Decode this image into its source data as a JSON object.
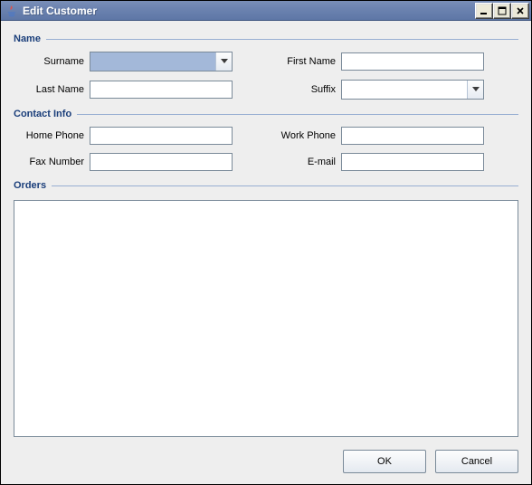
{
  "window": {
    "title": "Edit Customer"
  },
  "icons": {
    "minimize": "minimize-icon",
    "maximize": "maximize-icon",
    "close": "close-icon",
    "java": "java-icon",
    "chevron": "chevron-down-icon"
  },
  "sections": {
    "name": "Name",
    "contact": "Contact Info",
    "orders": "Orders"
  },
  "labels": {
    "surname": "Surname",
    "first_name": "First Name",
    "last_name": "Last Name",
    "suffix": "Suffix",
    "home_phone": "Home Phone",
    "work_phone": "Work Phone",
    "fax_number": "Fax Number",
    "email": "E-mail"
  },
  "values": {
    "surname": "",
    "first_name": "",
    "last_name": "",
    "suffix": "",
    "home_phone": "",
    "work_phone": "",
    "fax_number": "",
    "email": ""
  },
  "buttons": {
    "ok": "OK",
    "cancel": "Cancel"
  }
}
